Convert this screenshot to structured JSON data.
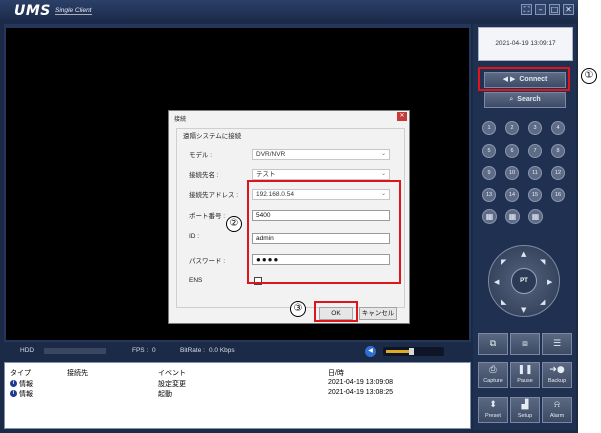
{
  "app": {
    "logo": "UMS",
    "logo_sub": "Single Client"
  },
  "window_controls": [
    "⛶",
    "–",
    "□",
    "✕"
  ],
  "status": {
    "hdd_label": "HDD",
    "fps_label": "FPS :",
    "fps_value": "0",
    "bitrate_label": "BitRate :",
    "bitrate_value": "0.0 Kbps",
    "volume_level": 0.45
  },
  "log": {
    "headers": {
      "type": "タイプ",
      "destination": "接続先",
      "event": "イベント",
      "datetime": "日/時"
    },
    "rows": [
      {
        "type": "情報",
        "destination": "",
        "event": "設定変更",
        "datetime": "2021-04-19 13:09:08"
      },
      {
        "type": "情報",
        "destination": "",
        "event": "起動",
        "datetime": "2021-04-19 13:08:25"
      }
    ]
  },
  "panel": {
    "clock": "2021-04-19 13:09:17",
    "connect_label": "Connect",
    "search_label": "Search",
    "channels": [
      "1",
      "2",
      "3",
      "4",
      "5",
      "6",
      "7",
      "8",
      "9",
      "10",
      "11",
      "12",
      "13",
      "14",
      "15",
      "16"
    ],
    "ptz_label": "PT",
    "tools": {
      "capture": "Capture",
      "pause": "Pause",
      "backup": "Backup",
      "preset": "Preset",
      "setup": "Setup",
      "alarm": "Alarm"
    }
  },
  "dialog": {
    "title": "接続",
    "group_label": "遠隔システムに接続",
    "model_label": "モデル :",
    "model_value": "DVR/NVR",
    "name_label": "接続先名 :",
    "name_value": "テスト",
    "address_label": "接続先アドレス :",
    "address_value": "192.168.0.54",
    "port_label": "ポート番号 :",
    "port_value": "5400",
    "id_label": "ID :",
    "id_value": "admin",
    "password_label": "パスワード :",
    "password_value": "●●●●",
    "ens_label": "ENS",
    "ok_label": "OK",
    "cancel_label": "キャンセル"
  },
  "annotations": {
    "marker1": "①",
    "marker2": "②",
    "marker3": "③",
    "highlight_color": "#e0151b"
  }
}
